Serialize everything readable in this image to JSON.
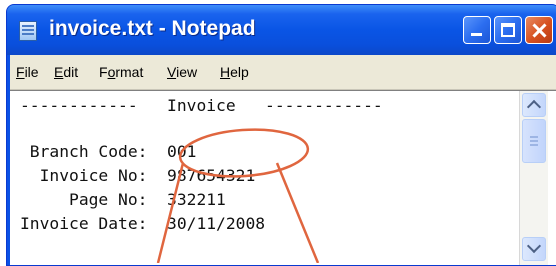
{
  "window": {
    "title": "invoice.txt - Notepad",
    "icon": "notepad-icon",
    "controls": [
      "minimize-icon",
      "maximize-icon",
      "close-icon"
    ]
  },
  "menubar": {
    "items": [
      {
        "mnemonic": "F",
        "rest": "ile"
      },
      {
        "mnemonic": "E",
        "rest": "dit"
      },
      {
        "pre": "F",
        "mnemonic": "o",
        "rest": "rmat"
      },
      {
        "mnemonic": "V",
        "rest": "iew"
      },
      {
        "mnemonic": "H",
        "rest": "elp"
      }
    ]
  },
  "document": {
    "lines": [
      "------------   Invoice   ------------",
      "",
      " Branch Code:  001",
      "  Invoice No:  987654321",
      "     Page No:  332211",
      "Invoice Date:  30/11/2008"
    ]
  },
  "scrollbar": {
    "icons": [
      "scroll-up-icon",
      "scroll-down-icon"
    ]
  },
  "colors": {
    "titlebar": "#0a55e5",
    "menubar": "#ece9d8",
    "annotation": "#e0663f",
    "close_button": "#d6501f"
  }
}
